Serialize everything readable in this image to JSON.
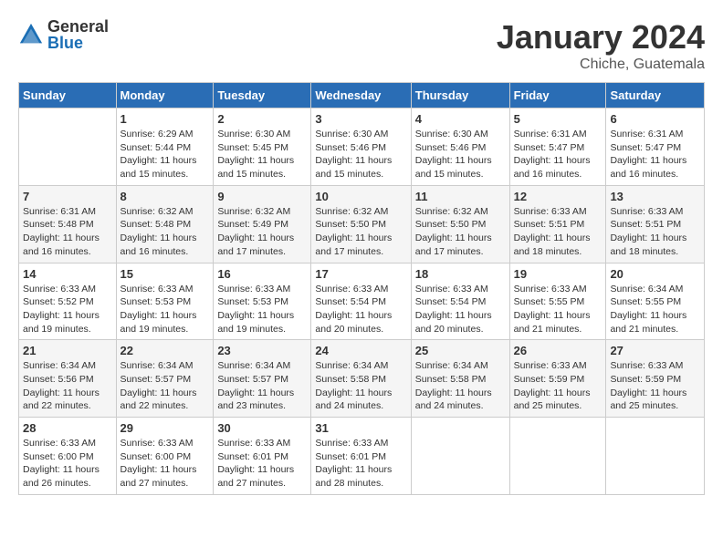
{
  "logo": {
    "general": "General",
    "blue": "Blue"
  },
  "title": "January 2024",
  "subtitle": "Chiche, Guatemala",
  "days_header": [
    "Sunday",
    "Monday",
    "Tuesday",
    "Wednesday",
    "Thursday",
    "Friday",
    "Saturday"
  ],
  "weeks": [
    [
      {
        "num": "",
        "info": ""
      },
      {
        "num": "1",
        "info": "Sunrise: 6:29 AM\nSunset: 5:44 PM\nDaylight: 11 hours\nand 15 minutes."
      },
      {
        "num": "2",
        "info": "Sunrise: 6:30 AM\nSunset: 5:45 PM\nDaylight: 11 hours\nand 15 minutes."
      },
      {
        "num": "3",
        "info": "Sunrise: 6:30 AM\nSunset: 5:46 PM\nDaylight: 11 hours\nand 15 minutes."
      },
      {
        "num": "4",
        "info": "Sunrise: 6:30 AM\nSunset: 5:46 PM\nDaylight: 11 hours\nand 15 minutes."
      },
      {
        "num": "5",
        "info": "Sunrise: 6:31 AM\nSunset: 5:47 PM\nDaylight: 11 hours\nand 16 minutes."
      },
      {
        "num": "6",
        "info": "Sunrise: 6:31 AM\nSunset: 5:47 PM\nDaylight: 11 hours\nand 16 minutes."
      }
    ],
    [
      {
        "num": "7",
        "info": "Sunrise: 6:31 AM\nSunset: 5:48 PM\nDaylight: 11 hours\nand 16 minutes."
      },
      {
        "num": "8",
        "info": "Sunrise: 6:32 AM\nSunset: 5:48 PM\nDaylight: 11 hours\nand 16 minutes."
      },
      {
        "num": "9",
        "info": "Sunrise: 6:32 AM\nSunset: 5:49 PM\nDaylight: 11 hours\nand 17 minutes."
      },
      {
        "num": "10",
        "info": "Sunrise: 6:32 AM\nSunset: 5:50 PM\nDaylight: 11 hours\nand 17 minutes."
      },
      {
        "num": "11",
        "info": "Sunrise: 6:32 AM\nSunset: 5:50 PM\nDaylight: 11 hours\nand 17 minutes."
      },
      {
        "num": "12",
        "info": "Sunrise: 6:33 AM\nSunset: 5:51 PM\nDaylight: 11 hours\nand 18 minutes."
      },
      {
        "num": "13",
        "info": "Sunrise: 6:33 AM\nSunset: 5:51 PM\nDaylight: 11 hours\nand 18 minutes."
      }
    ],
    [
      {
        "num": "14",
        "info": "Sunrise: 6:33 AM\nSunset: 5:52 PM\nDaylight: 11 hours\nand 19 minutes."
      },
      {
        "num": "15",
        "info": "Sunrise: 6:33 AM\nSunset: 5:53 PM\nDaylight: 11 hours\nand 19 minutes."
      },
      {
        "num": "16",
        "info": "Sunrise: 6:33 AM\nSunset: 5:53 PM\nDaylight: 11 hours\nand 19 minutes."
      },
      {
        "num": "17",
        "info": "Sunrise: 6:33 AM\nSunset: 5:54 PM\nDaylight: 11 hours\nand 20 minutes."
      },
      {
        "num": "18",
        "info": "Sunrise: 6:33 AM\nSunset: 5:54 PM\nDaylight: 11 hours\nand 20 minutes."
      },
      {
        "num": "19",
        "info": "Sunrise: 6:33 AM\nSunset: 5:55 PM\nDaylight: 11 hours\nand 21 minutes."
      },
      {
        "num": "20",
        "info": "Sunrise: 6:34 AM\nSunset: 5:55 PM\nDaylight: 11 hours\nand 21 minutes."
      }
    ],
    [
      {
        "num": "21",
        "info": "Sunrise: 6:34 AM\nSunset: 5:56 PM\nDaylight: 11 hours\nand 22 minutes."
      },
      {
        "num": "22",
        "info": "Sunrise: 6:34 AM\nSunset: 5:57 PM\nDaylight: 11 hours\nand 22 minutes."
      },
      {
        "num": "23",
        "info": "Sunrise: 6:34 AM\nSunset: 5:57 PM\nDaylight: 11 hours\nand 23 minutes."
      },
      {
        "num": "24",
        "info": "Sunrise: 6:34 AM\nSunset: 5:58 PM\nDaylight: 11 hours\nand 24 minutes."
      },
      {
        "num": "25",
        "info": "Sunrise: 6:34 AM\nSunset: 5:58 PM\nDaylight: 11 hours\nand 24 minutes."
      },
      {
        "num": "26",
        "info": "Sunrise: 6:33 AM\nSunset: 5:59 PM\nDaylight: 11 hours\nand 25 minutes."
      },
      {
        "num": "27",
        "info": "Sunrise: 6:33 AM\nSunset: 5:59 PM\nDaylight: 11 hours\nand 25 minutes."
      }
    ],
    [
      {
        "num": "28",
        "info": "Sunrise: 6:33 AM\nSunset: 6:00 PM\nDaylight: 11 hours\nand 26 minutes."
      },
      {
        "num": "29",
        "info": "Sunrise: 6:33 AM\nSunset: 6:00 PM\nDaylight: 11 hours\nand 27 minutes."
      },
      {
        "num": "30",
        "info": "Sunrise: 6:33 AM\nSunset: 6:01 PM\nDaylight: 11 hours\nand 27 minutes."
      },
      {
        "num": "31",
        "info": "Sunrise: 6:33 AM\nSunset: 6:01 PM\nDaylight: 11 hours\nand 28 minutes."
      },
      {
        "num": "",
        "info": ""
      },
      {
        "num": "",
        "info": ""
      },
      {
        "num": "",
        "info": ""
      }
    ]
  ]
}
